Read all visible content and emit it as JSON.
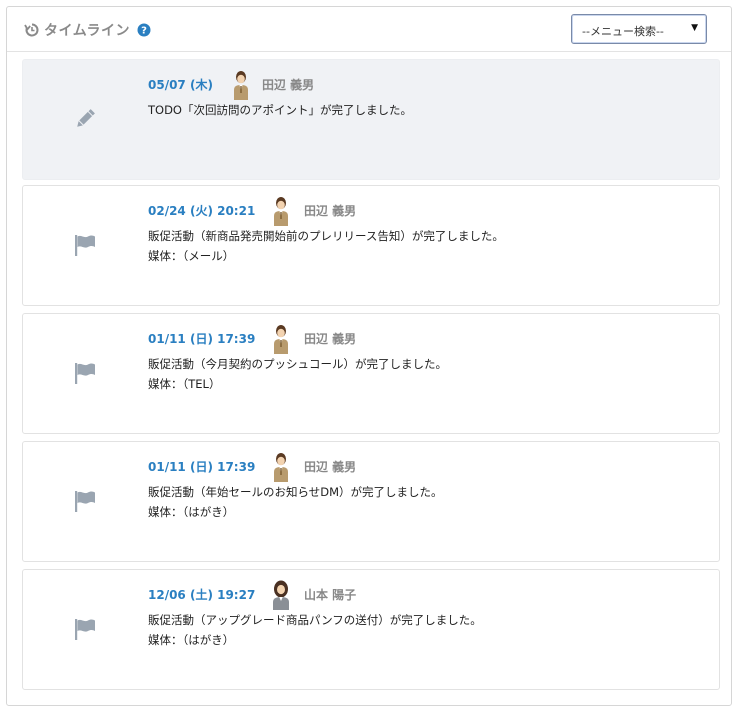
{
  "header": {
    "title": "タイムライン",
    "refresh_icon": "refresh-icon",
    "help_icon": "help-icon",
    "menu_select_value": "--メニュー検索--"
  },
  "colors": {
    "date": "#2a7fc1",
    "user": "#888888",
    "icon_gray": "#9aa5b1",
    "highlight_bg": "#f0f2f5"
  },
  "timeline": [
    {
      "icon": "pencil-icon",
      "date": "05/07 (木)",
      "user": "田辺 義男",
      "avatar": "avatar-male",
      "line1": "TODO「次回訪問のアポイント」が完了しました。",
      "line2": ""
    },
    {
      "icon": "flag-icon",
      "date": "02/24 (火) 20:21",
      "user": "田辺 義男",
      "avatar": "avatar-male",
      "line1": "販促活動（新商品発売開始前のプレリリース告知）が完了しました。",
      "line2": "媒体：（メール）"
    },
    {
      "icon": "flag-icon",
      "date": "01/11 (日) 17:39",
      "user": "田辺 義男",
      "avatar": "avatar-male",
      "line1": "販促活動（今月契約のプッシュコール）が完了しました。",
      "line2": "媒体：（TEL）"
    },
    {
      "icon": "flag-icon",
      "date": "01/11 (日) 17:39",
      "user": "田辺 義男",
      "avatar": "avatar-male",
      "line1": "販促活動（年始セールのお知らせDM）が完了しました。",
      "line2": "媒体：（はがき）"
    },
    {
      "icon": "flag-icon",
      "date": "12/06 (土) 19:27",
      "user": "山本 陽子",
      "avatar": "avatar-female",
      "line1": "販促活動（アップグレード商品パンフの送付）が完了しました。",
      "line2": "媒体：（はがき）"
    }
  ]
}
